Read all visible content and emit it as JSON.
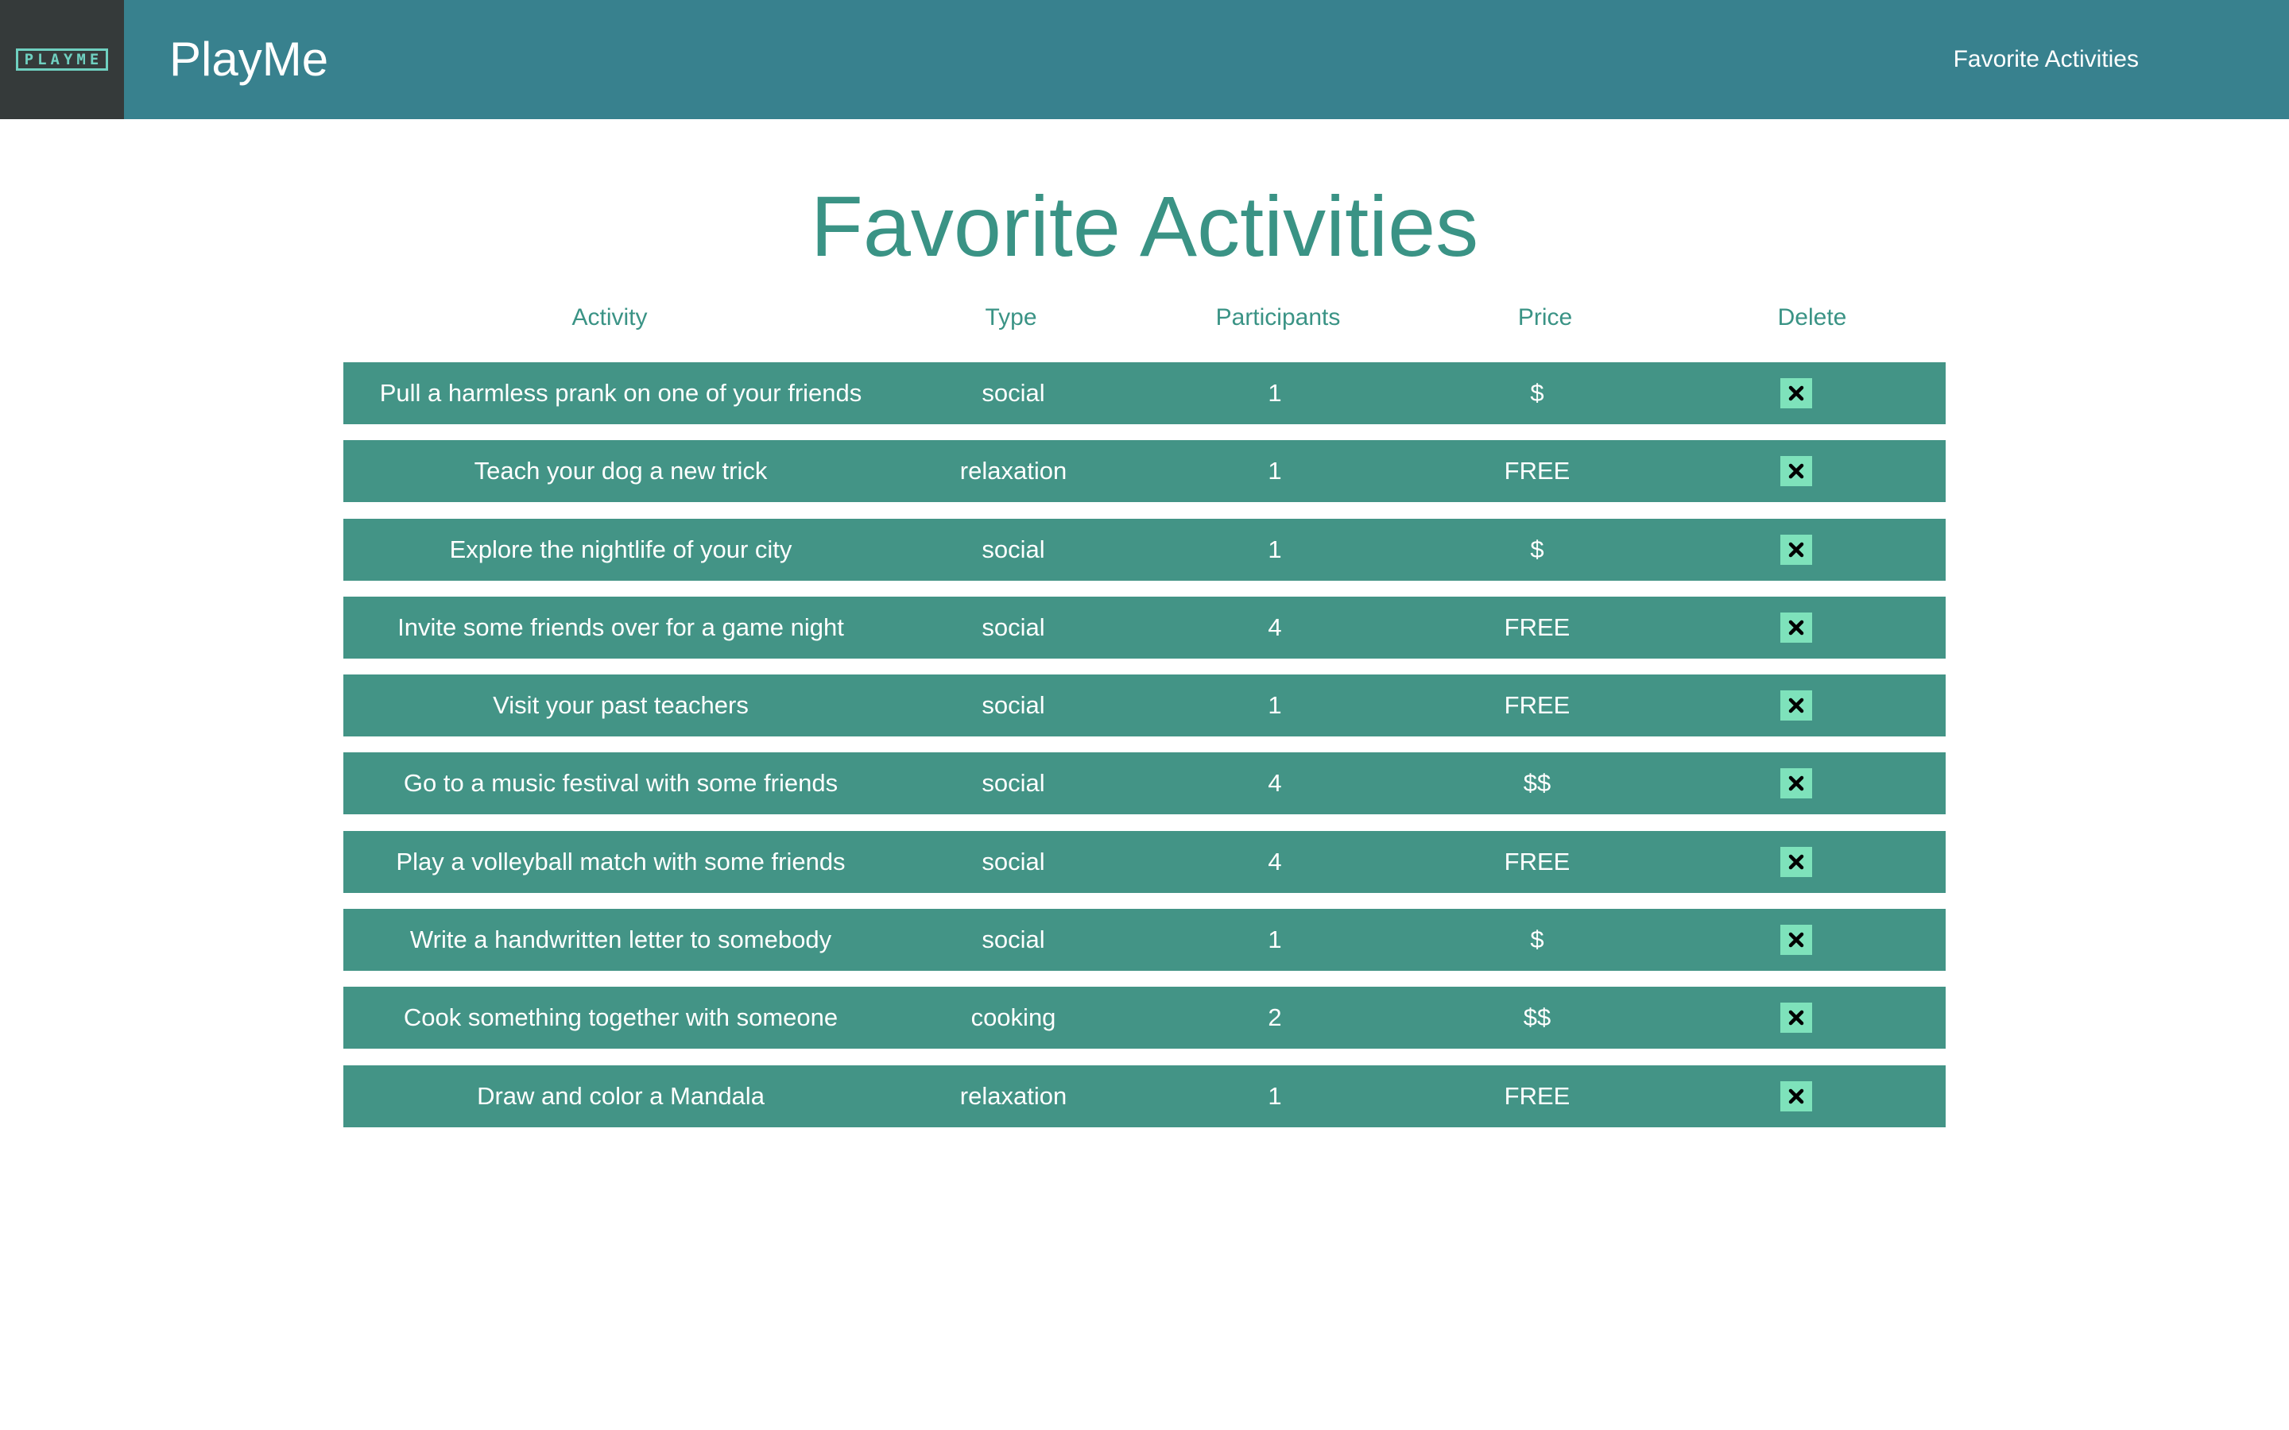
{
  "nav": {
    "logo_text": "PLAYME",
    "brand": "PlayMe",
    "link": "Favorite Activities"
  },
  "page": {
    "title": "Favorite Activities"
  },
  "table": {
    "headers": [
      "Activity",
      "Type",
      "Participants",
      "Price",
      "Delete"
    ],
    "rows": [
      {
        "activity": "Pull a harmless prank on one of your friends",
        "type": "social",
        "participants": "1",
        "price": "$"
      },
      {
        "activity": "Teach your dog a new trick",
        "type": "relaxation",
        "participants": "1",
        "price": "FREE"
      },
      {
        "activity": "Explore the nightlife of your city",
        "type": "social",
        "participants": "1",
        "price": "$"
      },
      {
        "activity": "Invite some friends over for a game night",
        "type": "social",
        "participants": "4",
        "price": "FREE"
      },
      {
        "activity": "Visit your past teachers",
        "type": "social",
        "participants": "1",
        "price": "FREE"
      },
      {
        "activity": "Go to a music festival with some friends",
        "type": "social",
        "participants": "4",
        "price": "$$"
      },
      {
        "activity": "Play a volleyball match with some friends",
        "type": "social",
        "participants": "4",
        "price": "FREE"
      },
      {
        "activity": "Write a handwritten letter to somebody",
        "type": "social",
        "participants": "1",
        "price": "$"
      },
      {
        "activity": "Cook something together with someone",
        "type": "cooking",
        "participants": "2",
        "price": "$$"
      },
      {
        "activity": "Draw and color a Mandala",
        "type": "relaxation",
        "participants": "1",
        "price": "FREE"
      }
    ],
    "delete_icon": "close-icon"
  },
  "colors": {
    "navbar": "#38818e",
    "logo_bg": "#353a3a",
    "row_bg": "#439486",
    "accent_text": "#3a9385",
    "delete_button": "#7ee2bb"
  }
}
